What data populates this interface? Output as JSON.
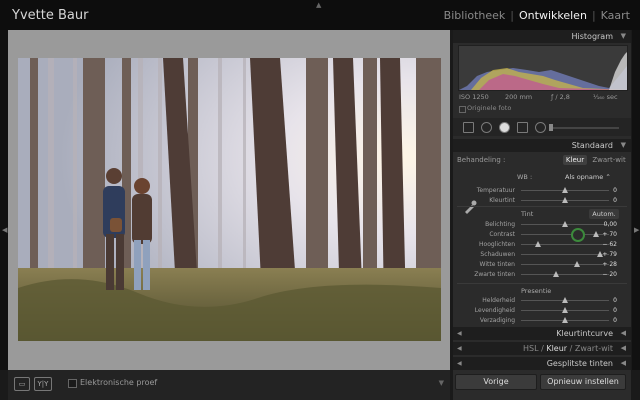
{
  "app": {
    "title": "Yvette Baur",
    "modules": [
      "Bibliotheek",
      "Ontwikkelen",
      "Kaart"
    ],
    "active_module": "Ontwikkelen"
  },
  "histogram": {
    "header": "Histogram",
    "iso": "ISO 1250",
    "focal": "200 mm",
    "aperture": "ƒ / 2,8",
    "shutter": "¹⁄₁₆₀ sec",
    "original_label": "Originele foto"
  },
  "basic": {
    "header": "Standaard",
    "treatment_label": "Behandeling :",
    "treatment_options": [
      "Kleur",
      "Zwart-wit"
    ],
    "wb_label": "WB :",
    "wb_value": "Als opname",
    "tone_label": "Tint",
    "auto_label": "Autom.",
    "presence_label": "Presentie",
    "wb_sliders": [
      {
        "label": "Temperatuur",
        "value": "0",
        "position": 0.5
      },
      {
        "label": "Kleurtint",
        "value": "0",
        "position": 0.5
      }
    ],
    "tone_sliders": [
      {
        "label": "Belichting",
        "value": "0,00",
        "position": 0.5
      },
      {
        "label": "Contrast",
        "value": "+ 70",
        "position": 0.85
      },
      {
        "label": "Hooglichten",
        "value": "− 62",
        "position": 0.19
      },
      {
        "label": "Schaduwen",
        "value": "+ 79",
        "position": 0.9
      },
      {
        "label": "Witte tinten",
        "value": "+ 28",
        "position": 0.64
      },
      {
        "label": "Zwarte tinten",
        "value": "− 20",
        "position": 0.4
      }
    ],
    "presence_sliders": [
      {
        "label": "Helderheid",
        "value": "0",
        "position": 0.5
      },
      {
        "label": "Levendigheid",
        "value": "0",
        "position": 0.5
      },
      {
        "label": "Verzadiging",
        "value": "0",
        "position": 0.5
      }
    ]
  },
  "panels": {
    "tone_curve": "Kleurtintcurve",
    "hsl_options": [
      "HSL",
      "Kleur",
      "Zwart-wit"
    ],
    "split_toning": "Gesplitste tinten"
  },
  "footer": {
    "previous": "Vorige",
    "reset": "Opnieuw instellen"
  },
  "toolbar": {
    "soft_proof": "Elektronische proef",
    "view_before_after": "Y|Y"
  },
  "colors": {
    "accent_green": "#3c8a3c",
    "panel_bg": "#2b2b2b",
    "canvas_bg": "#9a9a9a"
  }
}
